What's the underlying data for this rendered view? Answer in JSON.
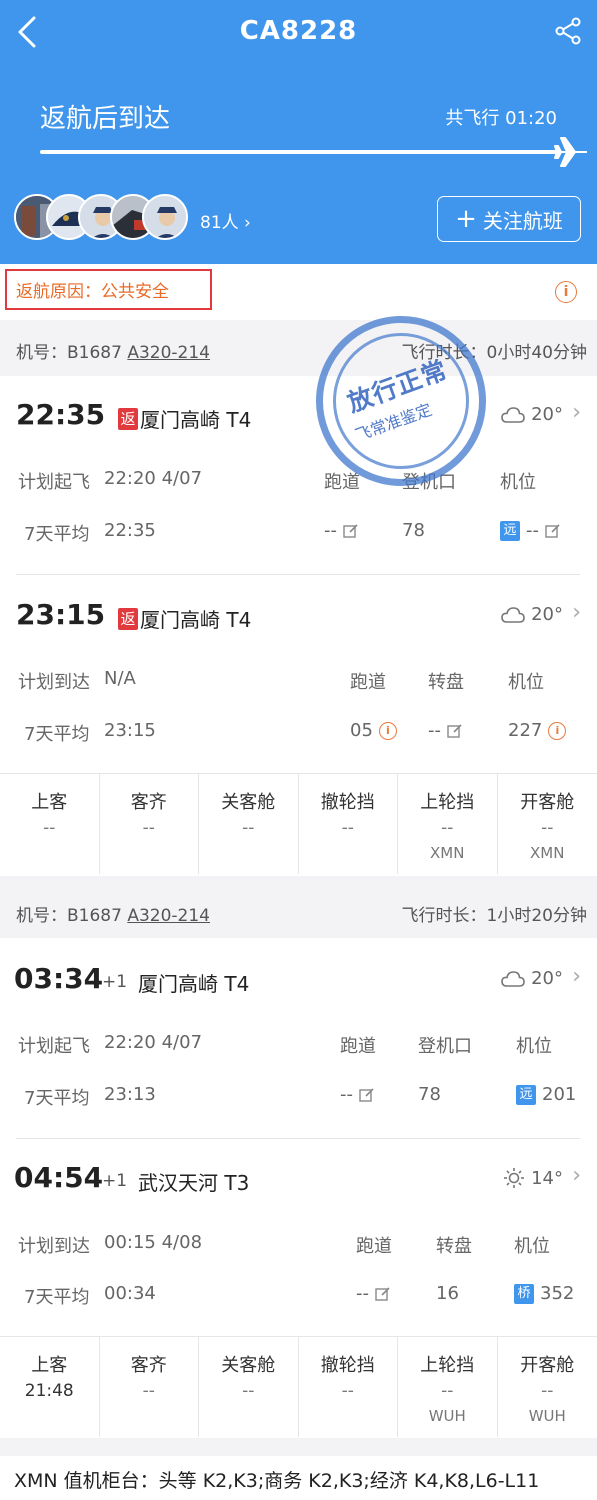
{
  "header": {
    "flight_no": "CA8228",
    "status": "返航后到达",
    "duration": "共飞行 01:20",
    "people_count": "81人",
    "follow_label": "关注航班"
  },
  "reason": {
    "text": "返航原因：公共安全"
  },
  "leg1": {
    "aircraft": "机号：B1687",
    "model": "A320-214",
    "flight_time": "飞行时长：0小时40分钟",
    "dep": {
      "time": "22:35",
      "tag": "返",
      "airport": "厦门高崎 T4",
      "temp": "20°",
      "sched_label": "计划起飞",
      "sched_value": "22:20 4/07",
      "col1": "跑道",
      "col2": "登机口",
      "col3": "机位",
      "avg_label": "7天平均",
      "avg_value": "22:35",
      "runway": "--",
      "gate": "78",
      "stand_tag": "远",
      "stand": "--"
    },
    "arr": {
      "time": "23:15",
      "tag": "返",
      "airport": "厦门高崎 T4",
      "temp": "20°",
      "sched_label": "计划到达",
      "sched_value": "N/A",
      "col1": "跑道",
      "col2": "转盘",
      "col3": "机位",
      "avg_label": "7天平均",
      "avg_value": "23:15",
      "runway": "05",
      "carousel": "--",
      "stand": "227"
    },
    "stats": [
      {
        "h": "上客",
        "v": "--",
        "s": ""
      },
      {
        "h": "客齐",
        "v": "--",
        "s": ""
      },
      {
        "h": "关客舱",
        "v": "--",
        "s": ""
      },
      {
        "h": "撤轮挡",
        "v": "--",
        "s": ""
      },
      {
        "h": "上轮挡",
        "v": "--",
        "s": "XMN"
      },
      {
        "h": "开客舱",
        "v": "--",
        "s": "XMN"
      }
    ]
  },
  "leg2": {
    "aircraft": "机号：B1687",
    "model": "A320-214",
    "flight_time": "飞行时长：1小时20分钟",
    "dep": {
      "time": "03:34",
      "plus": "+1",
      "airport": "厦门高崎 T4",
      "temp": "20°",
      "sched_label": "计划起飞",
      "sched_value": "22:20 4/07",
      "col1": "跑道",
      "col2": "登机口",
      "col3": "机位",
      "avg_label": "7天平均",
      "avg_value": "23:13",
      "runway": "--",
      "gate": "78",
      "stand_tag": "远",
      "stand": "201"
    },
    "arr": {
      "time": "04:54",
      "plus": "+1",
      "airport": "武汉天河 T3",
      "temp": "14°",
      "sched_label": "计划到达",
      "sched_value": "00:15 4/08",
      "col1": "跑道",
      "col2": "转盘",
      "col3": "机位",
      "avg_label": "7天平均",
      "avg_value": "00:34",
      "runway": "--",
      "carousel": "16",
      "stand_tag": "桥",
      "stand": "352"
    },
    "stats": [
      {
        "h": "上客",
        "v": "21:48",
        "s": ""
      },
      {
        "h": "客齐",
        "v": "--",
        "s": ""
      },
      {
        "h": "关客舱",
        "v": "--",
        "s": ""
      },
      {
        "h": "撤轮挡",
        "v": "--",
        "s": ""
      },
      {
        "h": "上轮挡",
        "v": "--",
        "s": "WUH"
      },
      {
        "h": "开客舱",
        "v": "--",
        "s": "WUH"
      }
    ]
  },
  "stamp": {
    "line1": "放行正常",
    "line2": "飞常准鉴定"
  },
  "footer": {
    "checkin": "XMN 值机柜台：头等 K2,K3;商务 K2,K3;经济 K4,K8,L6-L11"
  },
  "colors": {
    "header_bg": "#3f96ec",
    "return_tag": "#e0393e",
    "reason_text": "#e86b28"
  }
}
